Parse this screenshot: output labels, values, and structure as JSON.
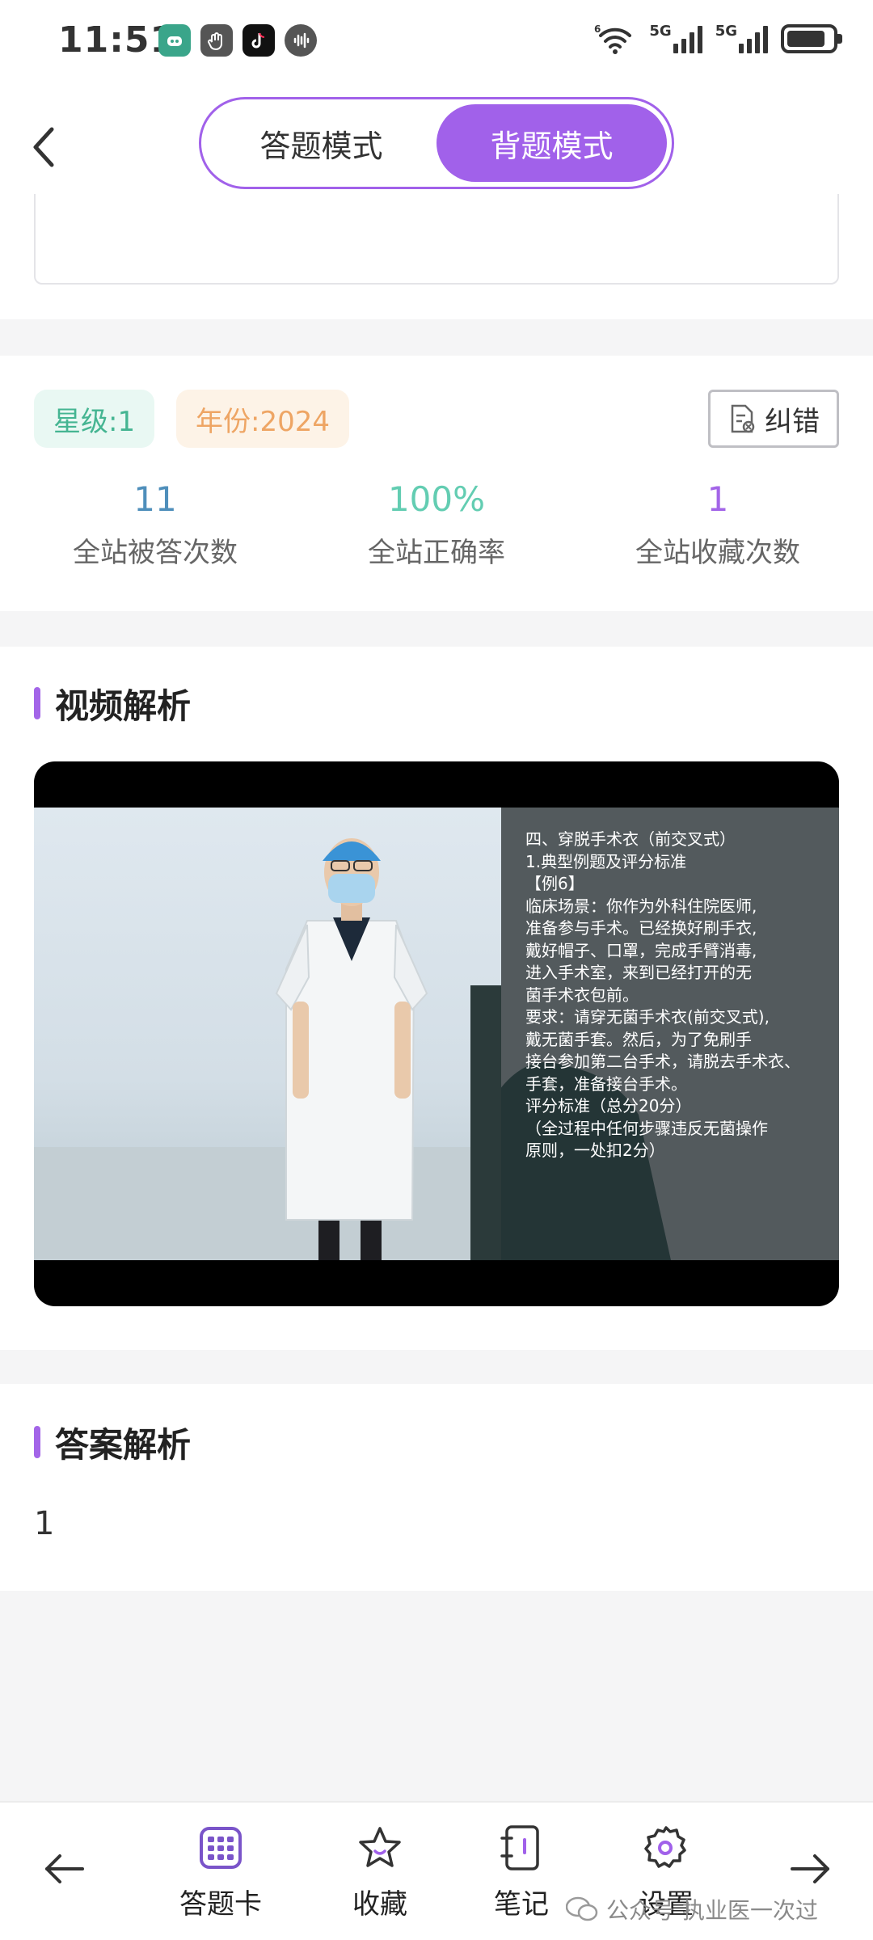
{
  "status_bar": {
    "time": "11:51",
    "network_1": "5G",
    "network_2": "5G",
    "icons": [
      "app-icon-green",
      "hand-icon",
      "tiktok-icon",
      "soundwave-icon",
      "wifi-icon",
      "signal-icon",
      "battery-icon"
    ]
  },
  "header": {
    "back_icon": "chevron-left-icon",
    "modes": [
      {
        "label": "答题模式",
        "active": false
      },
      {
        "label": "背题模式",
        "active": true
      }
    ],
    "accent_color": "#a161ea"
  },
  "stats": {
    "star_tag": "星级:1",
    "year_tag": "年份:2024",
    "correct_button": "纠错",
    "items": [
      {
        "value": "11",
        "label": "全站被答次数"
      },
      {
        "value": "100%",
        "label": "全站正确率"
      },
      {
        "value": "1",
        "label": "全站收藏次数"
      }
    ]
  },
  "video_section": {
    "title": "视频解析",
    "slide_text": "四、穿脱手术衣（前交叉式）\n1.典型例题及评分标准\n【例6】\n临床场景：你作为外科住院医师,\n准备参与手术。已经换好刷手衣,\n戴好帽子、口罩，完成手臂消毒,\n进入手术室，来到已经打开的无\n菌手术衣包前。\n要求：请穿无菌手术衣(前交叉式),\n戴无菌手套。然后，为了免刷手\n接台参加第二台手术，请脱去手术衣、\n手套，准备接台手术。\n评分标准（总分20分）\n（全过程中任何步骤违反无菌操作\n原则，一处扣2分）"
  },
  "answer_section": {
    "title": "答案解析",
    "text": "1"
  },
  "bottom_nav": {
    "prev_icon": "arrow-left-icon",
    "next_icon": "arrow-right-icon",
    "items": [
      {
        "label": "答题卡",
        "icon": "grid-card-icon"
      },
      {
        "label": "收藏",
        "icon": "star-icon"
      },
      {
        "label": "笔记",
        "icon": "notebook-icon"
      },
      {
        "label": "设置",
        "icon": "gear-icon"
      }
    ]
  },
  "watermark": {
    "prefix": "公众号",
    "name": "执业医一次过"
  }
}
